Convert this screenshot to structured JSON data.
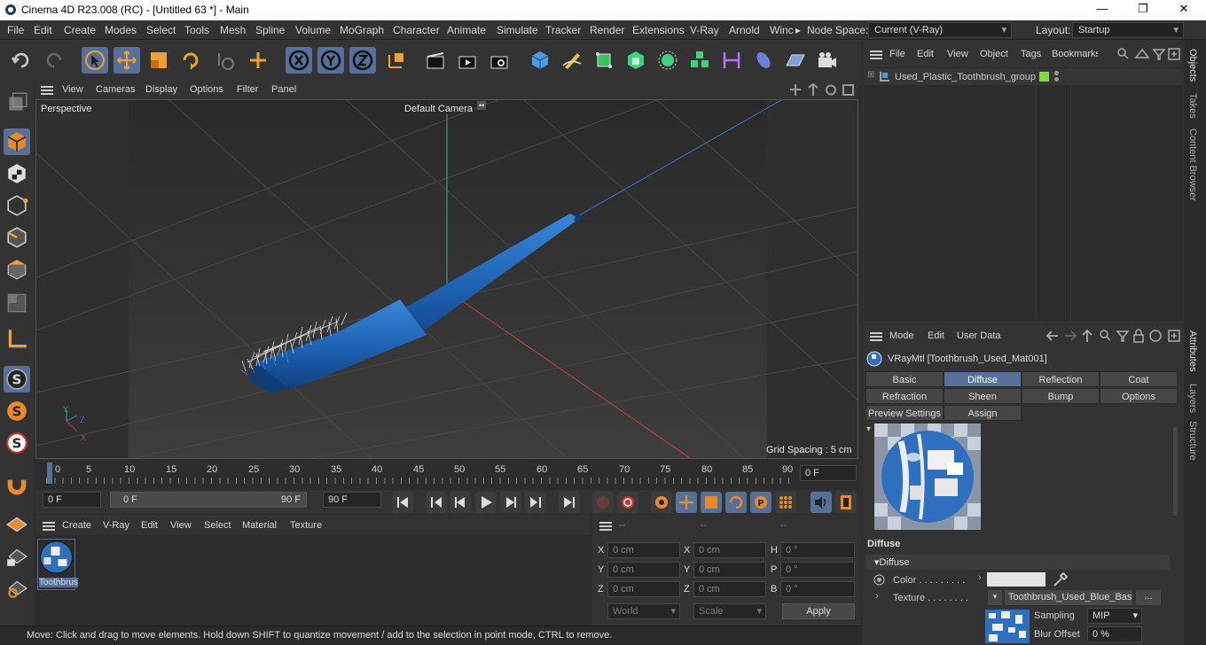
{
  "window": {
    "title": "Cinema 4D R23.008 (RC) - [Untitled 63 *] - Main",
    "controls": [
      "—",
      "❐",
      "✕"
    ]
  },
  "menubar": {
    "items": [
      "File",
      "Edit",
      "Create",
      "Modes",
      "Select",
      "Tools",
      "Mesh",
      "Spline",
      "Volume",
      "MoGraph",
      "Character",
      "Animate",
      "Simulate",
      "Tracker",
      "Render",
      "Extensions",
      "V-Ray",
      "Arnold",
      "Winc"
    ],
    "more": "▸",
    "node_space_label": "Node Space:",
    "node_space_value": "Current (V-Ray)",
    "layout_label": "Layout:",
    "layout_value": "Startup"
  },
  "viewport": {
    "menu": [
      "View",
      "Cameras",
      "Display",
      "Options",
      "Filter",
      "Panel"
    ],
    "projection": "Perspective",
    "camera": "Default Camera",
    "camera_icon": "••",
    "grid_spacing": "Grid Spacing : 5 cm",
    "axis_labels": {
      "y": "Y",
      "z": "Z",
      "x": "X"
    }
  },
  "timeline": {
    "ticks": [
      "0",
      "5",
      "10",
      "15",
      "20",
      "25",
      "30",
      "35",
      "40",
      "45",
      "50",
      "55",
      "60",
      "65",
      "70",
      "75",
      "80",
      "85",
      "90"
    ],
    "current_frame": "0 F"
  },
  "transport": {
    "start_field": "0 F",
    "range_start": "0 F",
    "range_end": "90 F",
    "end_field": "90 F"
  },
  "material_manager": {
    "menu": [
      "Create",
      "V-Ray",
      "Edit",
      "View",
      "Select",
      "Material",
      "Texture"
    ],
    "material_label": "Toothbrus"
  },
  "coordinates": {
    "headers": [
      "--",
      "--",
      "--"
    ],
    "rows": [
      {
        "a": "X",
        "av": "0 cm",
        "b": "X",
        "bv": "0 cm",
        "c": "H",
        "cv": "0 °"
      },
      {
        "a": "Y",
        "av": "0 cm",
        "b": "Y",
        "bv": "0 cm",
        "c": "P",
        "cv": "0 °"
      },
      {
        "a": "Z",
        "av": "0 cm",
        "b": "Z",
        "bv": "0 cm",
        "c": "B",
        "cv": "0 °"
      }
    ],
    "mode1": "World",
    "mode2": "Scale",
    "apply": "Apply"
  },
  "status": "Move: Click and drag to move elements. Hold down SHIFT to quantize movement / add to the selection in point mode, CTRL to remove.",
  "objects": {
    "menu": [
      "File",
      "Edit",
      "View",
      "Object",
      "Tags",
      "Bookmarks"
    ],
    "items": [
      {
        "name": "Used_Plastic_Toothbrush_group"
      }
    ]
  },
  "attributes": {
    "menu": [
      "Mode",
      "Edit",
      "User Data"
    ],
    "material_title": "VRayMtl [Toothbrush_Used_Mat001]",
    "tabs_row1": [
      "Basic",
      "Diffuse",
      "Reflection",
      "Coat"
    ],
    "tabs_row2": [
      "Refraction",
      "Sheen",
      "Bump",
      "Options"
    ],
    "tabs_row3": [
      "Preview Settings",
      "Assign"
    ],
    "active_tab": "Diffuse",
    "section": "Diffuse",
    "group": "▾Diffuse",
    "color_label": "Color . . . . . . . . .",
    "texture_label": "Texture . . . . . . . .",
    "texture_value": "Toothbrush_Used_Blue_Base",
    "texture_more": "...",
    "sampling_label": "Sampling",
    "sampling_value": "MIP",
    "blur_label": "Blur Offset",
    "blur_value": "0 %"
  },
  "right_tabs": [
    "Objects",
    "Takes",
    "Content Browser",
    "Attributes",
    "Layers",
    "Structure"
  ],
  "colors": {
    "accent": "#56709a",
    "bg": "#333333",
    "brush_blue": "#1f63b4",
    "green_tag": "#7fdc3c"
  }
}
